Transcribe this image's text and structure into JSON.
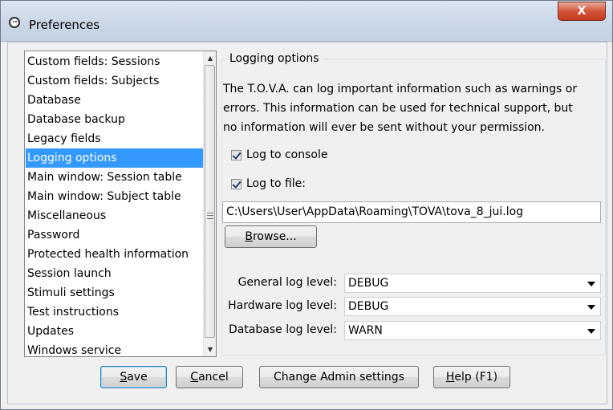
{
  "window": {
    "title": "Preferences",
    "close_glyph": "X"
  },
  "sidebar": {
    "items": [
      {
        "label": "Custom fields: Sessions",
        "selected": false
      },
      {
        "label": "Custom fields: Subjects",
        "selected": false
      },
      {
        "label": "Database",
        "selected": false
      },
      {
        "label": "Database backup",
        "selected": false
      },
      {
        "label": "Legacy fields",
        "selected": false
      },
      {
        "label": "Logging options",
        "selected": true
      },
      {
        "label": "Main window: Session table",
        "selected": false
      },
      {
        "label": "Main window: Subject table",
        "selected": false
      },
      {
        "label": "Miscellaneous",
        "selected": false
      },
      {
        "label": "Password",
        "selected": false
      },
      {
        "label": "Protected health information",
        "selected": false
      },
      {
        "label": "Session launch",
        "selected": false
      },
      {
        "label": "Stimuli settings",
        "selected": false
      },
      {
        "label": "Test instructions",
        "selected": false
      },
      {
        "label": "Updates",
        "selected": false
      },
      {
        "label": "Windows service",
        "selected": false
      }
    ]
  },
  "panel": {
    "title": "Logging options",
    "description": [
      "The T.O.V.A. can log important information such as warnings or",
      "errors. This information can be used for technical support, but",
      "no information will ever be sent without your permission."
    ],
    "log_to_console": {
      "label": "Log to console",
      "checked": true
    },
    "log_to_file": {
      "label": "Log to file:",
      "checked": true
    },
    "log_path": "C:\\Users\\User\\AppData\\Roaming\\TOVA\\tova_8_jui.log",
    "browse": {
      "mnemonic": "B",
      "rest": "rowse..."
    },
    "levels": [
      {
        "label": "General log level:",
        "value": "DEBUG"
      },
      {
        "label": "Hardware log level:",
        "value": "DEBUG"
      },
      {
        "label": "Database log level:",
        "value": "WARN"
      }
    ]
  },
  "buttons": {
    "save": {
      "mnemonic": "S",
      "rest": "ave"
    },
    "cancel": {
      "mnemonic": "C",
      "rest": "ancel"
    },
    "admin": {
      "label": "Change Admin settings"
    },
    "help": {
      "mnemonic": "H",
      "rest": "elp (F1)"
    }
  },
  "colors": {
    "selection": "#3399ff",
    "dialog_bg": "#f0f0f0",
    "close_button": "#c23a1f"
  }
}
